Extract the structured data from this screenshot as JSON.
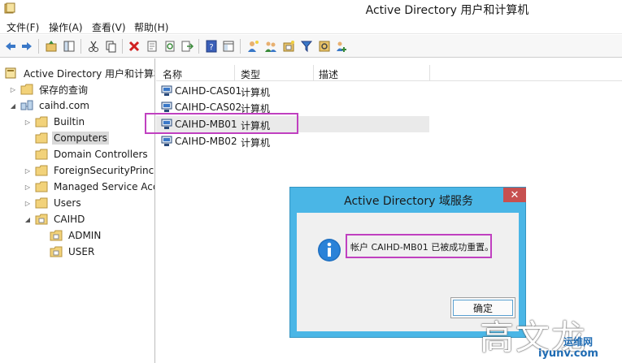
{
  "window": {
    "title": "Active Directory 用户和计算机"
  },
  "menu": {
    "items": [
      "文件(F)",
      "操作(A)",
      "查看(V)",
      "帮助(H)"
    ]
  },
  "toolbar": {
    "buttons": [
      "back-arrow-icon",
      "forward-arrow-icon",
      "up-folder-icon",
      "show-tree-icon",
      "cut-icon",
      "copy-icon",
      "delete-icon",
      "properties-icon",
      "refresh-icon",
      "export-list-icon",
      "help-icon",
      "console-tree-icon",
      "new-user-icon",
      "new-group-icon",
      "new-ou-icon",
      "filter-icon",
      "find-icon",
      "add-to-group-icon"
    ]
  },
  "tree": {
    "items": [
      {
        "label": "Active Directory 用户和计算机",
        "icon": "ad-root-icon",
        "expand": ""
      },
      {
        "label": "保存的查询",
        "icon": "folder-icon",
        "expand": "▷"
      },
      {
        "label": "caihd.com",
        "icon": "domain-icon",
        "expand": "◢"
      },
      {
        "label": "Builtin",
        "icon": "folder-icon",
        "expand": "▷"
      },
      {
        "label": "Computers",
        "icon": "folder-icon",
        "expand": ""
      },
      {
        "label": "Domain Controllers",
        "icon": "folder-icon",
        "expand": ""
      },
      {
        "label": "ForeignSecurityPrincipa",
        "icon": "folder-icon",
        "expand": "▷"
      },
      {
        "label": "Managed Service Acco",
        "icon": "folder-icon",
        "expand": "▷"
      },
      {
        "label": "Users",
        "icon": "folder-icon",
        "expand": "▷"
      },
      {
        "label": "CAIHD",
        "icon": "ou-folder-icon",
        "expand": "◢"
      },
      {
        "label": "ADMIN",
        "icon": "ou-folder-icon",
        "expand": ""
      },
      {
        "label": "USER",
        "icon": "ou-folder-icon",
        "expand": ""
      }
    ]
  },
  "list": {
    "columns": [
      "名称",
      "类型",
      "描述"
    ],
    "rows": [
      {
        "name": "CAIHD-CAS01",
        "type": "计算机"
      },
      {
        "name": "CAIHD-CAS02",
        "type": "计算机"
      },
      {
        "name": "CAIHD-MB01",
        "type": "计算机"
      },
      {
        "name": "CAIHD-MB02",
        "type": "计算机"
      }
    ]
  },
  "dialog": {
    "title": "Active Directory 域服务",
    "message": "帐户 CAIHD-MB01 已被成功重置。",
    "ok_label": "确定",
    "close_label": "✕"
  },
  "watermark": {
    "text": "高文龙",
    "site": "运维网",
    "url": "iyunv.com"
  },
  "colors": {
    "dialog_frame": "#4ab6e6",
    "highlight_box": "#c040c0",
    "close_button": "#c75050"
  }
}
